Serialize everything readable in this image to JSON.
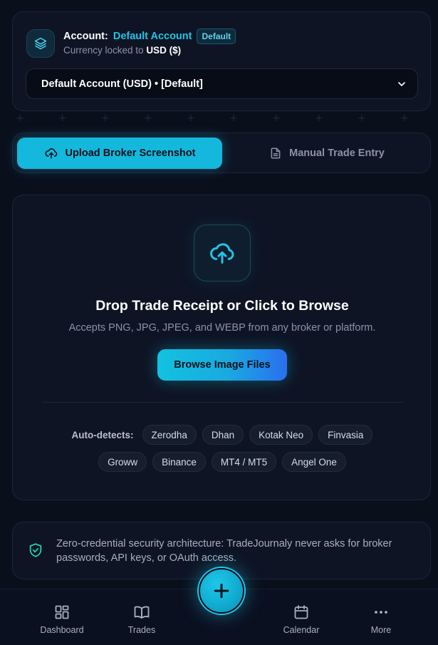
{
  "account": {
    "label": "Account:",
    "name": "Default Account",
    "badge": "Default",
    "currency_prefix": "Currency locked to",
    "currency": "USD ($)",
    "selected": "Default Account (USD) • [Default]"
  },
  "tabs": {
    "upload": "Upload Broker Screenshot",
    "manual": "Manual Trade Entry"
  },
  "upload": {
    "title": "Drop Trade Receipt or Click to Browse",
    "description": "Accepts PNG, JPG, JPEG, and WEBP from any broker or platform.",
    "browse_label": "Browse Image Files",
    "auto_label": "Auto-detects:",
    "brokers_row1": [
      "Zerodha",
      "Dhan",
      "Kotak Neo",
      "Finvasia"
    ],
    "brokers_row2": [
      "Groww",
      "Binance",
      "MT4 / MT5",
      "Angel One"
    ]
  },
  "security": {
    "text": "Zero-credential security architecture: TradeJournaly never asks for broker passwords, API keys, or OAuth access."
  },
  "nav": {
    "dashboard": "Dashboard",
    "trades": "Trades",
    "calendar": "Calendar",
    "more": "More"
  },
  "colors": {
    "accent": "#14b8dc",
    "accent_text": "#22c3e6",
    "background": "#0a0f1c",
    "card": "#0e1424",
    "security_icon": "#22d3a6"
  },
  "icons": {
    "account": "layers-icon",
    "select": "chevron-down-icon",
    "upload_tab": "cloud-upload-icon",
    "manual_tab": "file-text-icon",
    "drop": "cloud-upload-icon",
    "security": "shield-check-icon",
    "dashboard": "grid-icon",
    "trades": "book-open-icon",
    "add": "plus-icon",
    "calendar": "calendar-icon",
    "more": "more-dots-icon"
  }
}
